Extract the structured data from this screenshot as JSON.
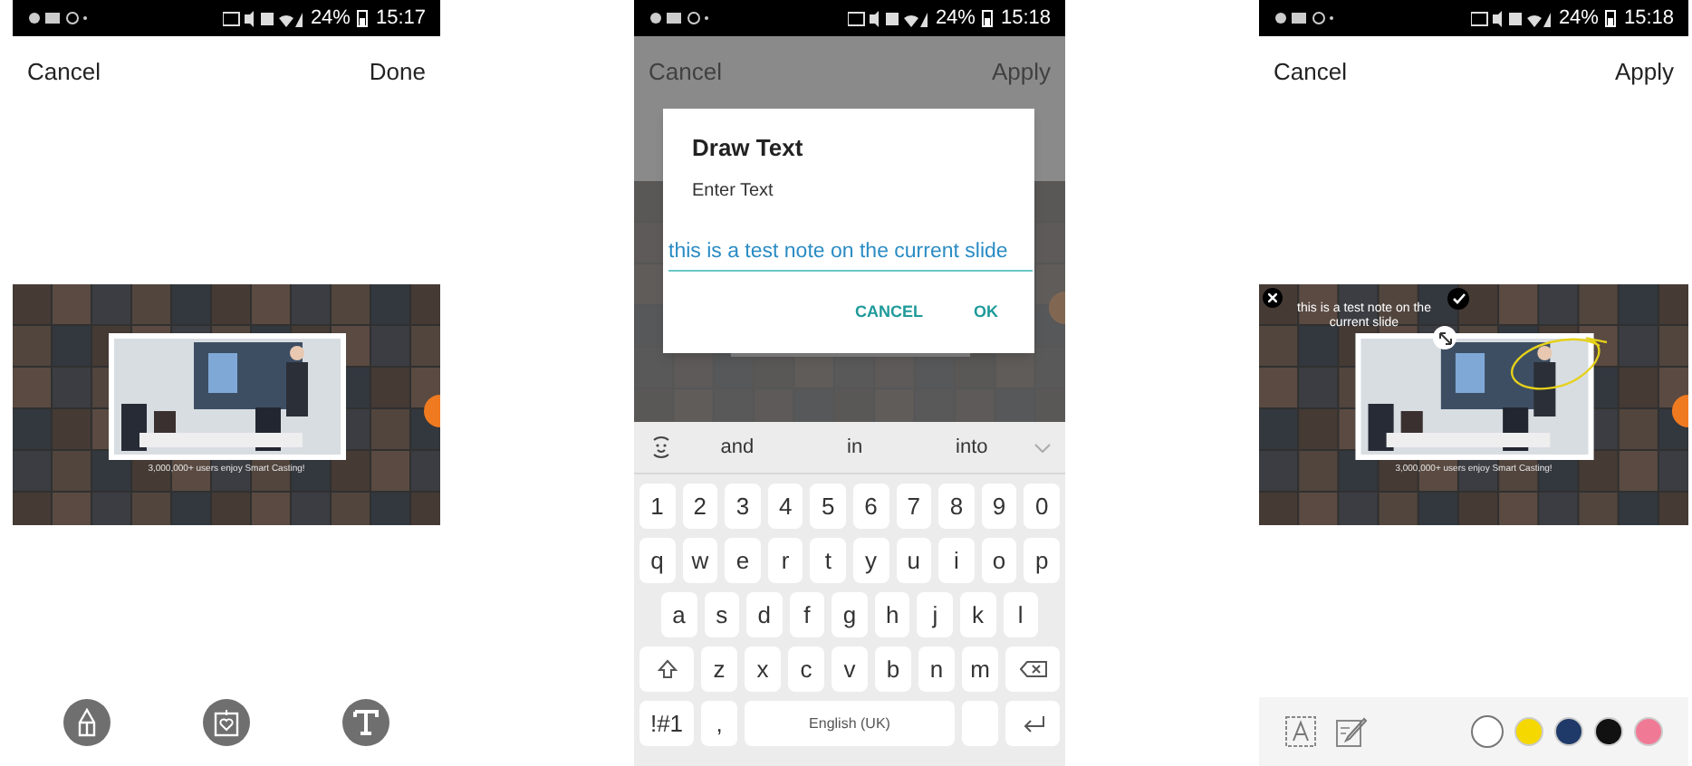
{
  "screens": [
    {
      "kind": "tools",
      "status_bar": {
        "battery": "24%",
        "time": "15:17"
      },
      "header": {
        "cancel": "Cancel",
        "confirm": "Done"
      },
      "slide": {
        "caption": "3,000,000+ users enjoy Smart Casting!"
      }
    },
    {
      "kind": "dialog",
      "status_bar": {
        "battery": "24%",
        "time": "15:18"
      },
      "header": {
        "cancel": "Cancel",
        "confirm": "Apply"
      },
      "dialog": {
        "title": "Draw Text",
        "label": "Enter Text",
        "value": "this is a test note on the current slide",
        "buttons": [
          "CANCEL",
          "OK"
        ]
      },
      "keyboard": {
        "suggestions": [
          "and",
          "in",
          "into"
        ],
        "rows": [
          [
            "1",
            "2",
            "3",
            "4",
            "5",
            "6",
            "7",
            "8",
            "9",
            "0"
          ],
          [
            "q",
            "w",
            "e",
            "r",
            "t",
            "y",
            "u",
            "i",
            "o",
            "p"
          ],
          [
            "a",
            "s",
            "d",
            "f",
            "g",
            "h",
            "j",
            "k",
            "l"
          ],
          [
            "z",
            "x",
            "c",
            "v",
            "b",
            "n",
            "m"
          ]
        ],
        "symbols": "!#1",
        "comma": ",",
        "language": "English (UK)"
      }
    },
    {
      "kind": "annotate",
      "status_bar": {
        "battery": "24%",
        "time": "15:18"
      },
      "header": {
        "cancel": "Cancel",
        "confirm": "Apply"
      },
      "slide": {
        "caption": "3,000,000+ users enjoy Smart Casting!",
        "note": "this is a test note on the current slide"
      },
      "colors": [
        {
          "color": "#ffffff",
          "selected": true
        },
        {
          "color": "#f5d800",
          "selected": false
        },
        {
          "color": "#1f3a68",
          "selected": false
        },
        {
          "color": "#111111",
          "selected": false
        },
        {
          "color": "#f07a96",
          "selected": false
        }
      ]
    }
  ]
}
